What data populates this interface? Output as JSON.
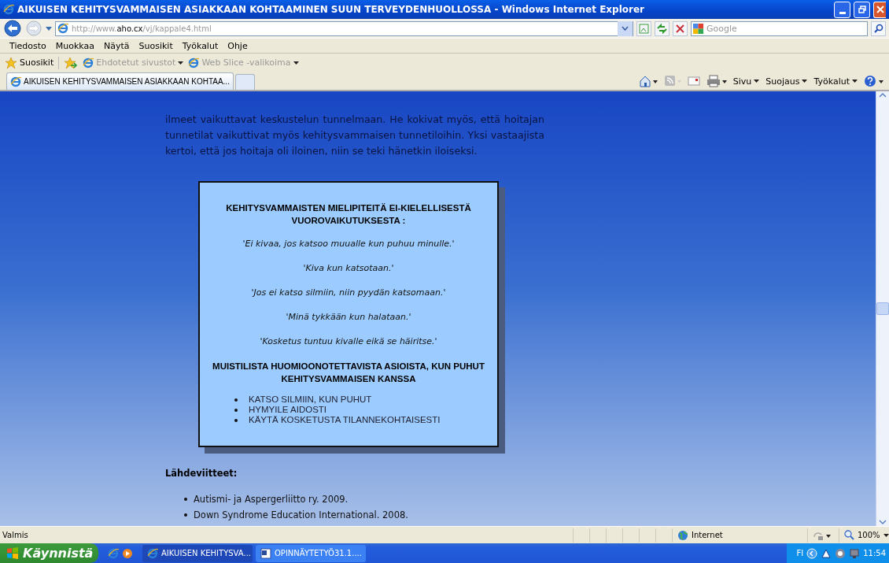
{
  "window": {
    "title": "AIKUISEN KEHITYSVAMMAISEN ASIAKKAAN KOHTAAMINEN SUUN TERVEYDENHUOLLOSSA - Windows Internet Explorer"
  },
  "address": {
    "prefix": "http://www.",
    "host": "aho.cx",
    "path": "/vj/kappale4.html"
  },
  "search": {
    "placeholder": "Google"
  },
  "menu": [
    "Tiedosto",
    "Muokkaa",
    "Näytä",
    "Suosikit",
    "Työkalut",
    "Ohje"
  ],
  "favorites_bar": {
    "favorites": "Suosikit",
    "links": [
      {
        "label": "Ehdotetut sivustot",
        "disabled": true
      },
      {
        "label": "Web Slice -valikoima",
        "disabled": true
      }
    ]
  },
  "tabs": [
    {
      "label": "AIKUISEN KEHITYSVAMMAISEN ASIAKKAAN KOHTAA...",
      "selected": true
    }
  ],
  "command_bar": [
    "Sivu",
    "Suojaus",
    "Työkalut"
  ],
  "content": {
    "paragraph": "ilmeet vaikuttavat keskustelun tunnelmaan. He kokivat myös, että hoitajan tunnetilat vaikuttivat myös kehitysvammaisen tunnetiloihin. Yksi vastaajista kertoi, että jos hoitaja oli iloinen, niin se teki hänetkin iloiseksi.",
    "infobox": {
      "heading": "KEHITYSVAMMAISTEN MIELIPITEITÄ EI-KIELELLISESTÄ VUOROVAIKUTUKSESTA :",
      "quotes": [
        "'Ei kivaa, jos katsoo muualle kun puhuu minulle.'",
        "'Kiva kun katsotaan.'",
        "'Jos ei katso silmiin, niin pyydän katsomaan.'",
        "'Minä tykkään kun halataan.'",
        "'Kosketus tuntuu kivalle eikä se häiritse.'"
      ],
      "heading2": "MUISTILISTA HUOMIOONOTETTAVISTA ASIOISTA, KUN PUHUT KEHITYSVAMMAISEN KANSSA",
      "bullets": [
        "KATSO SILMIIN, KUN PUHUT",
        "HYMYILE AIDOSTI",
        "KÄYTÄ KOSKETUSTA TILANNEKOHTAISESTI"
      ]
    },
    "references": {
      "heading": "Lähdeviitteet:",
      "items": [
        "Autismi- ja Aspergerliitto ry. 2009.",
        "Down Syndrome Education International. 2008."
      ]
    }
  },
  "status_bar": {
    "text": "Valmis",
    "zone": "Internet",
    "zoom": "100%"
  },
  "taskbar": {
    "start": "Käynnistä",
    "tasks": [
      {
        "label": "AIKUISEN KEHITYSVA...",
        "selected": true,
        "kind": "browser"
      },
      {
        "label": "OPINNÄYTETYÖ31.1....",
        "selected": false,
        "kind": "document"
      }
    ],
    "language": "FI",
    "clock": "11:54"
  }
}
